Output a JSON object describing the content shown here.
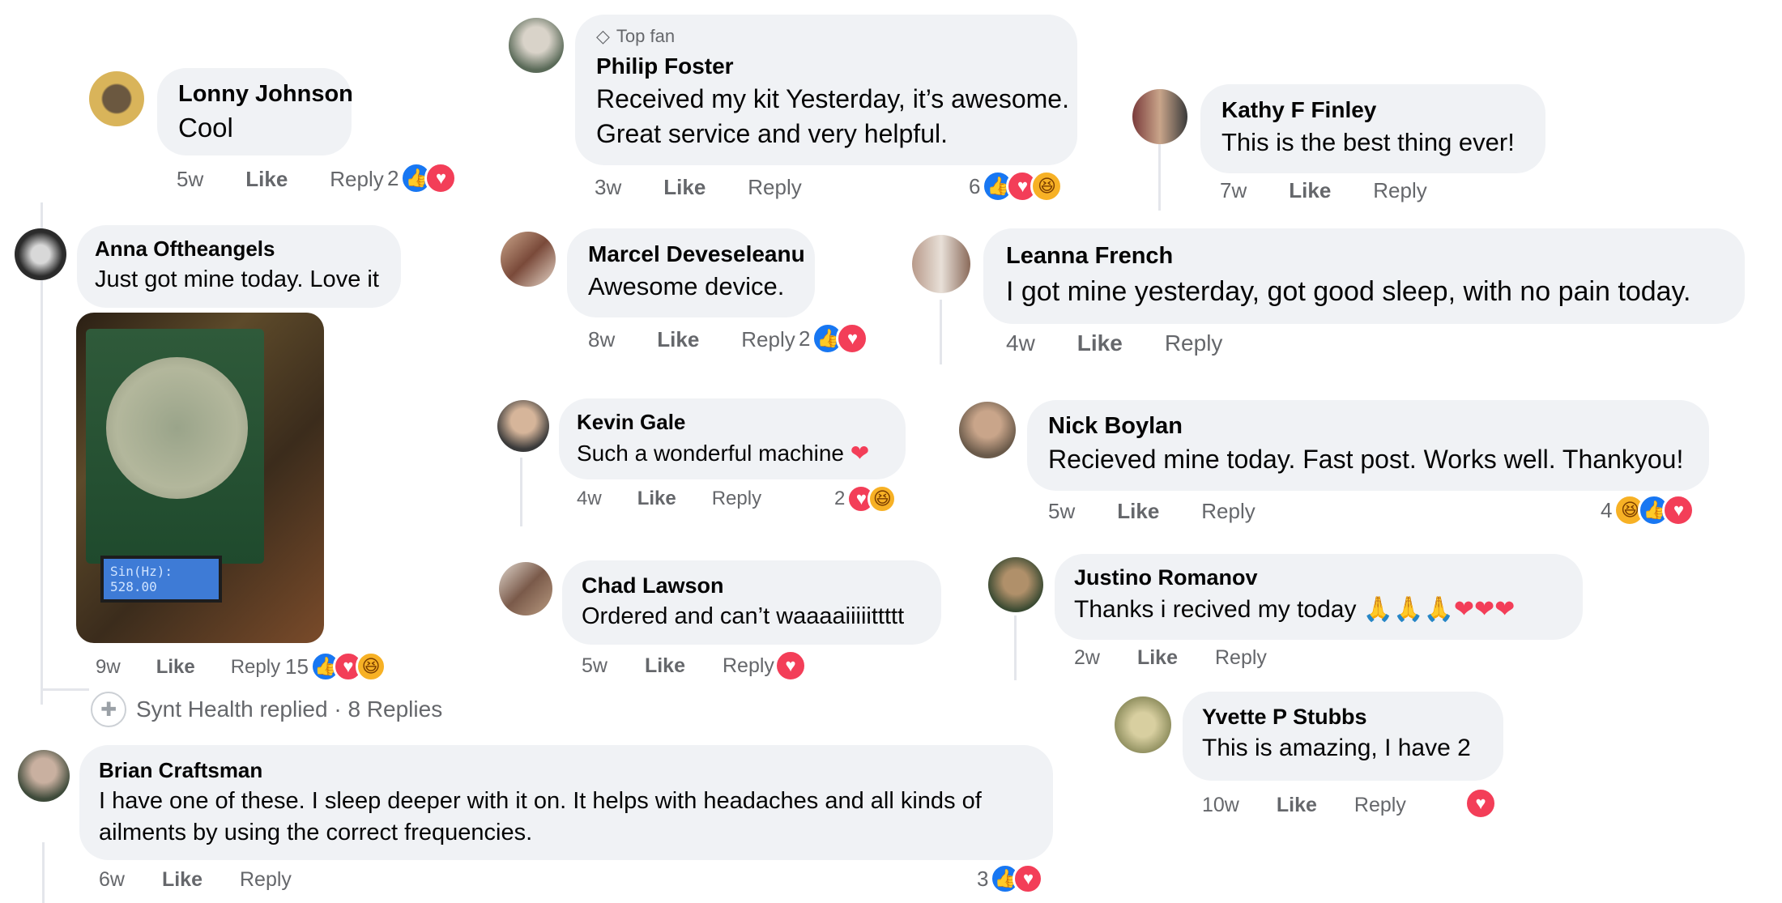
{
  "colors": {
    "like": "#1877f2",
    "love": "#f33e58",
    "haha": "#f7b125",
    "bubble": "#f0f2f5",
    "meta": "#65676b"
  },
  "labels": {
    "like": "Like",
    "reply": "Reply"
  },
  "comments": {
    "lonny": {
      "name": "Lonny Johnson",
      "text": "Cool",
      "time": "5w",
      "count": "2"
    },
    "philip": {
      "badge": "Top fan",
      "name": "Philip Foster",
      "text1": "Received my kit Yesterday, it’s awesome.",
      "text2": "Great service and very helpful.",
      "time": "3w",
      "count": "6"
    },
    "kathy": {
      "name": "Kathy F Finley",
      "text": "This is the best thing ever!",
      "time": "7w"
    },
    "anna": {
      "name": "Anna Oftheangels",
      "text": "Just got mine today. Love it",
      "time": "9w",
      "count": "15",
      "lcd1": "Sin(Hz):",
      "lcd2": "528.00"
    },
    "marcel": {
      "name": "Marcel Deveseleanu",
      "text": "Awesome device.",
      "time": "8w",
      "count": "2"
    },
    "leanna": {
      "name": "Leanna French",
      "text": "I got mine yesterday, got good sleep, with no pain today.",
      "time": "4w"
    },
    "kevin": {
      "name": "Kevin Gale",
      "text": "Such a wonderful machine",
      "time": "4w",
      "count": "2"
    },
    "nick": {
      "name": "Nick Boylan",
      "text": "Recieved mine today. Fast post. Works well. Thankyou!",
      "time": "5w",
      "count": "4"
    },
    "chad": {
      "name": "Chad Lawson",
      "text": "Ordered and can’t waaaaiiiiittttt",
      "time": "5w"
    },
    "justino": {
      "name": "Justino Romanov",
      "text": "Thanks i recived my today",
      "time": "2w"
    },
    "yvette": {
      "name": "Yvette P Stubbs",
      "text": "This is amazing, I have 2",
      "time": "10w"
    },
    "brian": {
      "name": "Brian Craftsman",
      "text1": "I have one of these. I sleep deeper with it on. It helps with headaches and all kinds of",
      "text2": "ailments by using the correct frequencies.",
      "time": "6w",
      "count": "3"
    }
  },
  "replied": {
    "text": "Synt Health replied · 8 Replies"
  }
}
